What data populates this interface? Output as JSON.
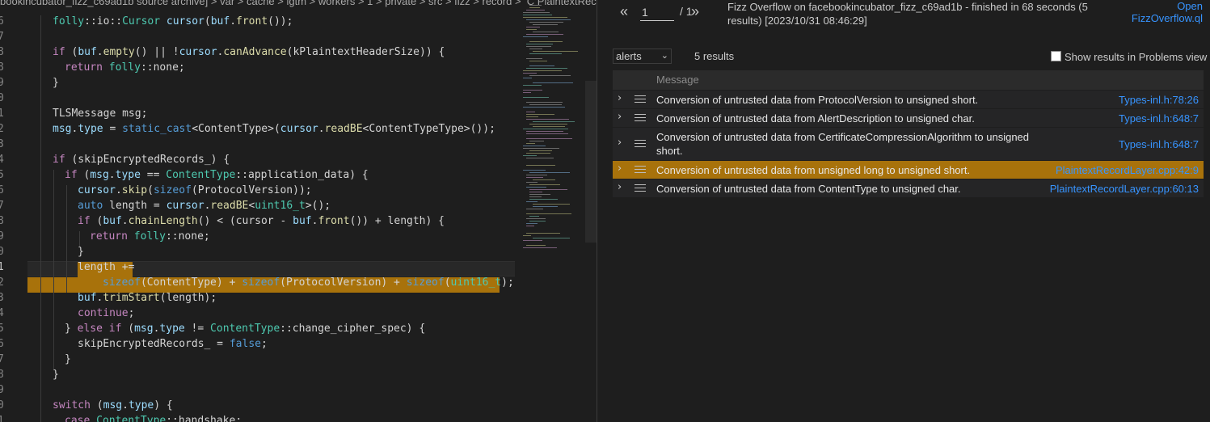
{
  "editor": {
    "breadcrumb": "bookincubator_fizz_c69ad1b source archive] > var > cache > lgtm > workers > 1 > private > src > fizz > record >  C PlaintextRec",
    "line_numbers": [
      "6",
      "7",
      "8",
      "8",
      "9",
      "0",
      "1",
      "2",
      "3",
      "4",
      "5",
      "6",
      "7",
      "8",
      "9",
      "0",
      "1",
      "2",
      "3",
      "4",
      "5",
      "6",
      "7",
      "8",
      "9",
      "0",
      "1"
    ],
    "code": {
      "l0": {
        "a": "folly",
        "b": "::io::",
        "c": "Cursor",
        "d": " ",
        "e": "cursor",
        "f": "(",
        "g": "buf",
        "h": ".",
        "i": "front",
        "j": "());"
      },
      "l1": {
        "a": "if",
        "b": " (",
        "c": "buf",
        "d": ".",
        "e": "empty",
        "f": "() || !",
        "g": "cursor",
        "h": ".",
        "i": "canAdvance",
        "j": "(kPlaintextHeaderSize)) {"
      },
      "l2": {
        "a": "return",
        "b": " ",
        "c": "folly",
        "d": "::none;"
      },
      "l3": {
        "a": "}"
      },
      "l4": {
        "a": "TLSMessage msg;"
      },
      "l5": {
        "a": "msg",
        "b": ".",
        "c": "type",
        "d": " = ",
        "e": "static_cast",
        "f": "<",
        "g": "ContentType",
        "h": ">(",
        "i": "cursor",
        "j": ".",
        "k": "readBE",
        "l": "<",
        "m": "ContentTypeType",
        "n": ">());"
      },
      "l6": {
        "a": "if",
        "b": " (skipEncryptedRecords_) {"
      },
      "l7": {
        "a": "if",
        "b": " (",
        "c": "msg",
        "d": ".",
        "e": "type",
        "f": " == ",
        "g": "ContentType",
        "h": "::application_data) {"
      },
      "l8": {
        "a": "cursor",
        "b": ".",
        "c": "skip",
        "d": "(",
        "e": "sizeof",
        "f": "(ProtocolVersion));"
      },
      "l9": {
        "a": "auto",
        "b": " length = ",
        "c": "cursor",
        "d": ".",
        "e": "readBE",
        "f": "<",
        "g": "uint16_t",
        "h": ">();"
      },
      "l10": {
        "a": "if",
        "b": " (",
        "c": "buf",
        "d": ".",
        "e": "chainLength",
        "f": "() < (cursor - ",
        "g": "buf",
        "h": ".",
        "i": "front",
        "j": "()) + length) {"
      },
      "l11": {
        "a": "return",
        "b": " ",
        "c": "folly",
        "d": "::none;"
      },
      "l12": {
        "a": "}"
      },
      "l13": {
        "a": "length +="
      },
      "l14": {
        "a": "sizeof",
        "b": "(ContentType) + ",
        "c": "sizeof",
        "d": "(ProtocolVersion) + ",
        "e": "sizeof",
        "f": "(",
        "g": "uint16_t",
        "h": ");"
      },
      "l15": {
        "a": "buf",
        "b": ".",
        "c": "trimStart",
        "d": "(length);"
      },
      "l16": {
        "a": "continue",
        "b": ";"
      },
      "l17": {
        "a": "} ",
        "b": "else",
        "c": " ",
        "d": "if",
        "e": " (",
        "f": "msg",
        "g": ".",
        "h": "type",
        "i": " != ",
        "j": "ContentType",
        "k": "::change_cipher_spec) {"
      },
      "l18": {
        "a": "skipEncryptedRecords_ = ",
        "b": "false",
        "c": ";"
      },
      "l19": {
        "a": "}"
      },
      "l20": {
        "a": "}"
      },
      "l21": {
        "a": "switch",
        "b": " (",
        "c": "msg",
        "d": ".",
        "e": "type",
        "f": ") {"
      },
      "l22": {
        "a": "case",
        "b": " ",
        "c": "ContentType",
        "d": "::handshake:"
      }
    }
  },
  "results": {
    "pager": {
      "first": "«",
      "page": "1",
      "total": "/ 1",
      "next": "»"
    },
    "title": "Fizz Overflow on facebookincubator_fizz_c69ad1b - finished in 68 seconds (5 results) [2023/10/31 08:46:29]",
    "open_link": "Open FizzOverflow.ql",
    "view_select": "alerts",
    "result_count": "5 results",
    "problems_checkbox": {
      "label": "Show results in Problems view",
      "checked": false
    },
    "table_header": "Message",
    "rows": [
      {
        "message": "Conversion of untrusted data from ProtocolVersion to unsigned short.",
        "location": "Types-inl.h:78:26",
        "selected": false
      },
      {
        "message": "Conversion of untrusted data from AlertDescription to unsigned char.",
        "location": "Types-inl.h:648:7",
        "selected": false
      },
      {
        "message": "Conversion of untrusted data from CertificateCompressionAlgorithm to unsigned short.",
        "location": "Types-inl.h:648:7",
        "selected": false
      },
      {
        "message": "Conversion of untrusted data from unsigned long to unsigned short.",
        "location": "PlaintextRecordLayer.cpp:42:9",
        "selected": true
      },
      {
        "message": "Conversion of untrusted data from ContentType to unsigned char.",
        "location": "PlaintextRecordLayer.cpp:60:13",
        "selected": false
      }
    ],
    "colors": {
      "accent": "#3794ff",
      "selection": "#a8720b"
    },
    "icons": {
      "expand": "chevron-right-icon",
      "list": "list-icon",
      "first": "double-chevron-left-icon",
      "next": "double-chevron-right-icon"
    }
  }
}
